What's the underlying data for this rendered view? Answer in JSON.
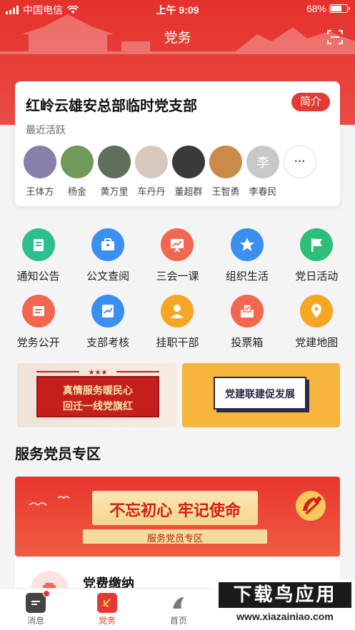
{
  "status_bar": {
    "carrier": "中国电信",
    "time": "上午 9:09",
    "battery": "68%",
    "battery_level": 0.68
  },
  "header": {
    "title": "党务"
  },
  "branch": {
    "name": "红岭云雄安总部临时党支部",
    "intro_label": "简介",
    "recent_label": "最近活跃",
    "members": [
      {
        "name": "王体方",
        "avatar_color": "#8a7fa8"
      },
      {
        "name": "杨金",
        "avatar_color": "#6f9a5a"
      },
      {
        "name": "黄万里",
        "avatar_color": "#5f6f5a"
      },
      {
        "name": "车丹丹",
        "avatar_color": "#d8c9bf"
      },
      {
        "name": "董超群",
        "avatar_color": "#3a3a3a"
      },
      {
        "name": "王智勇",
        "avatar_color": "#c98a4a"
      },
      {
        "name": "李春民",
        "avatar_color": "#c8c8c8",
        "initial": "李"
      }
    ],
    "more_label": "···"
  },
  "functions": [
    {
      "label": "通知公告",
      "color": "#2dbf8d",
      "icon": "notice-icon"
    },
    {
      "label": "公文查阅",
      "color": "#3b8ff0",
      "icon": "briefcase-icon"
    },
    {
      "label": "三会一课",
      "color": "#f2674f",
      "icon": "presentation-icon"
    },
    {
      "label": "组织生活",
      "color": "#3b8ff0",
      "icon": "star-badge-icon"
    },
    {
      "label": "党日活动",
      "color": "#2dbf7a",
      "icon": "flag-icon"
    },
    {
      "label": "党务公开",
      "color": "#f2674f",
      "icon": "document-icon"
    },
    {
      "label": "支部考核",
      "color": "#3b8ff0",
      "icon": "chart-card-icon"
    },
    {
      "label": "挂职干部",
      "color": "#f7a524",
      "icon": "person-icon"
    },
    {
      "label": "投票箱",
      "color": "#f2674f",
      "icon": "ballot-box-icon"
    },
    {
      "label": "党建地图",
      "color": "#f7a524",
      "icon": "map-pin-icon"
    }
  ],
  "banners": {
    "left_line1": "真情服务暖民心",
    "left_line2": "回迁一线党旗红",
    "right": "党建联建促发展"
  },
  "section": {
    "title": "服务党员专区",
    "slogan": "不忘初心 牢记使命",
    "strip": "服务党员专区"
  },
  "fee": {
    "title": "党费缴纳"
  },
  "tabs": [
    {
      "label": "消息",
      "icon": "message-icon",
      "active": false
    },
    {
      "label": "党务",
      "icon": "party-emblem-icon",
      "active": true
    },
    {
      "label": "首页",
      "icon": "home-logo-icon",
      "active": false
    }
  ],
  "watermark": {
    "top": "下载鸟应用",
    "bottom": "www.xiazainiao.com"
  }
}
